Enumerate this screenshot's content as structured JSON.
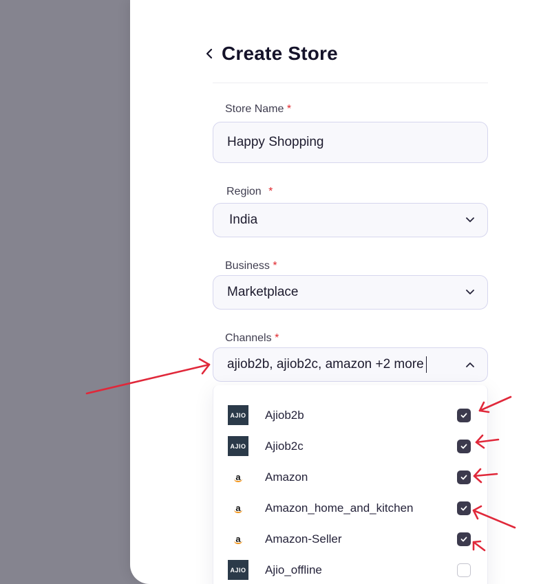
{
  "header": {
    "title": "Create Store"
  },
  "form": {
    "store_name": {
      "label": "Store Name",
      "required": "*",
      "value": "Happy Shopping"
    },
    "region": {
      "label": "Region",
      "required": "*",
      "value": "India"
    },
    "business": {
      "label": "Business",
      "required": "*",
      "value": "Marketplace"
    },
    "channels": {
      "label": "Channels",
      "required": "*",
      "value": "ajiob2b, ajiob2c, amazon +2 more"
    }
  },
  "channel_options": [
    {
      "logo": "AJIO",
      "logo_type": "ajio",
      "label": "Ajiob2b",
      "checked": true
    },
    {
      "logo": "AJIO",
      "logo_type": "ajio",
      "label": "Ajiob2c",
      "checked": true
    },
    {
      "logo": "a",
      "logo_type": "amazon",
      "label": "Amazon",
      "checked": true
    },
    {
      "logo": "a",
      "logo_type": "amazon",
      "label": "Amazon_home_and_kitchen",
      "checked": true
    },
    {
      "logo": "a",
      "logo_type": "amazon",
      "label": "Amazon-Seller",
      "checked": true
    },
    {
      "logo": "AJIO",
      "logo_type": "ajio",
      "label": "Ajio_offline",
      "checked": false
    }
  ],
  "colors": {
    "overlay": "#85848f",
    "checkbox_checked": "#3c3a4d",
    "required": "#e0282e",
    "annotation_arrow": "#e0283a"
  }
}
